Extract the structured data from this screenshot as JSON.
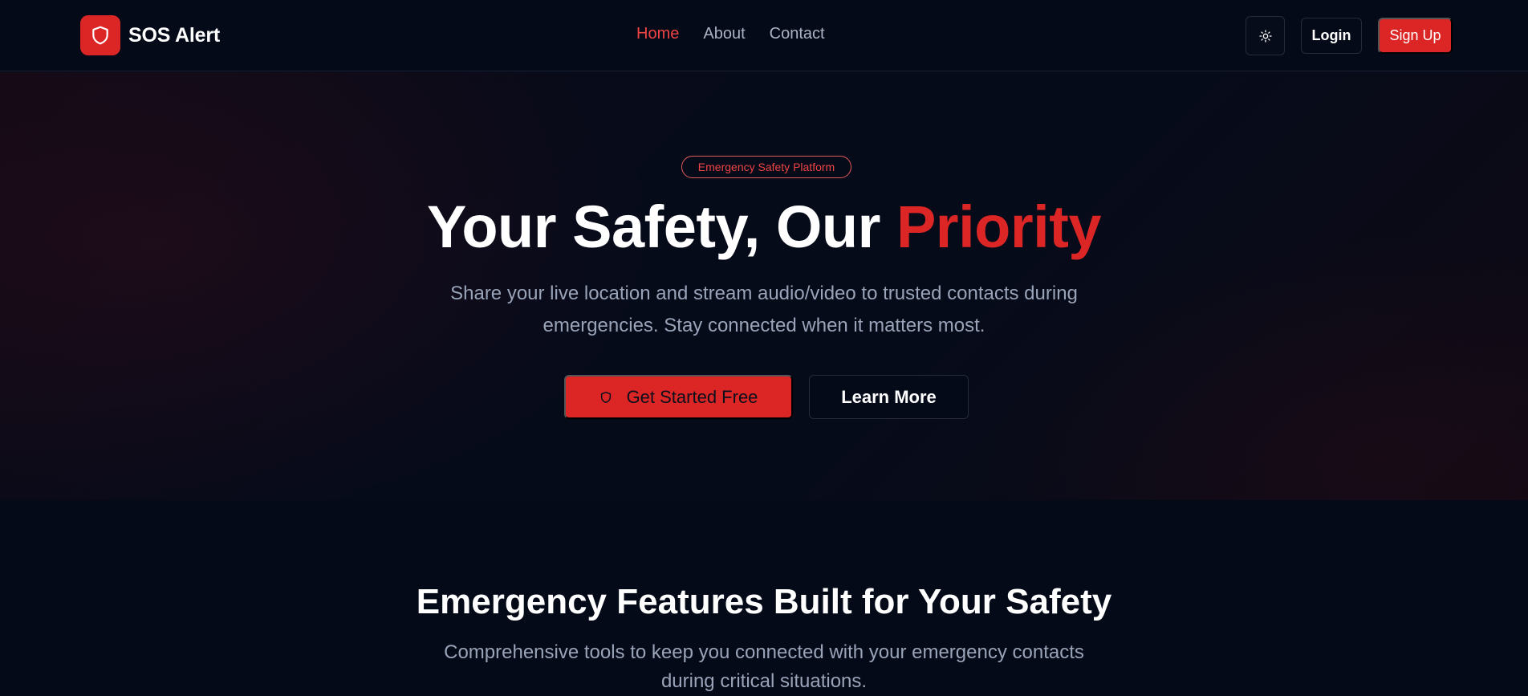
{
  "brand": {
    "name": "SOS Alert",
    "logo_icon": "shield-icon",
    "color": "#dc2626"
  },
  "nav": {
    "items": [
      {
        "label": "Home",
        "active": true
      },
      {
        "label": "About",
        "active": false
      },
      {
        "label": "Contact",
        "active": false
      }
    ]
  },
  "header": {
    "theme_toggle_icon": "sun-icon",
    "login_label": "Login",
    "signup_label": "Sign Up"
  },
  "hero": {
    "badge": "Emergency Safety Platform",
    "title_main": "Your Safety, Our ",
    "title_accent": "Priority",
    "subtitle": "Share your live location and stream audio/video to trusted contacts during emergencies. Stay connected when it matters most.",
    "cta_primary": "Get Started Free",
    "cta_primary_icon": "shield-icon",
    "cta_secondary": "Learn More"
  },
  "features": {
    "title": "Emergency Features Built for Your Safety",
    "subtitle": "Comprehensive tools to keep you connected with your emergency contacts during critical situations."
  },
  "colors": {
    "accent": "#dc2626",
    "background": "#050a18",
    "muted_text": "#9aa4b8"
  }
}
